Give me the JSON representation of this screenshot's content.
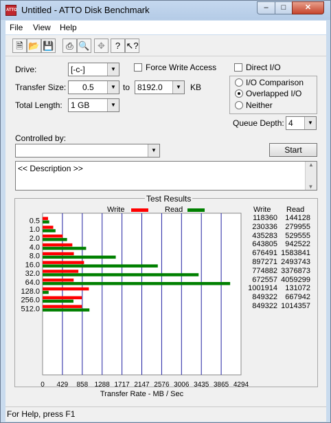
{
  "window": {
    "title": "Untitled - ATTO Disk Benchmark",
    "app_icon_text": "ATTO"
  },
  "menu": {
    "items": [
      "File",
      "View",
      "Help"
    ]
  },
  "toolbar": {
    "buttons": [
      "new-icon",
      "open-icon",
      "save-icon",
      "print-icon",
      "print-preview-icon",
      "move-icon",
      "help-icon",
      "context-help-icon"
    ]
  },
  "form": {
    "drive_label": "Drive:",
    "drive_value": "[-c-]",
    "force_write_label": "Force Write Access",
    "direct_io_label": "Direct I/O",
    "transfer_size_label": "Transfer Size:",
    "transfer_from": "0.5",
    "to_label": "to",
    "transfer_to": "8192.0",
    "kb_label": "KB",
    "total_length_label": "Total Length:",
    "total_length_value": "1 GB",
    "io_comparison_label": "I/O Comparison",
    "overlapped_io_label": "Overlapped I/O",
    "neither_label": "Neither",
    "queue_depth_label": "Queue Depth:",
    "queue_depth_value": "4",
    "controlled_by_label": "Controlled by:",
    "controlled_by_value": "",
    "start_label": "Start",
    "description_text": "<< Description >>"
  },
  "results": {
    "group_title": "Test Results",
    "write_col": "Write",
    "read_col": "Read",
    "rows": [
      {
        "write": "118360",
        "read": "144128"
      },
      {
        "write": "230336",
        "read": "279955"
      },
      {
        "write": "435283",
        "read": "529555"
      },
      {
        "write": "643805",
        "read": "942522"
      },
      {
        "write": "676491",
        "read": "1583841"
      },
      {
        "write": "897271",
        "read": "2493743"
      },
      {
        "write": "774882",
        "read": "3376873"
      },
      {
        "write": "672557",
        "read": "4059299"
      },
      {
        "write": "1001914",
        "read": "131072"
      },
      {
        "write": "849322",
        "read": "667942"
      },
      {
        "write": "849322",
        "read": "1014357"
      }
    ]
  },
  "chart_data": {
    "type": "bar",
    "orientation": "horizontal",
    "categories": [
      "0.5",
      "1.0",
      "2.0",
      "4.0",
      "8.0",
      "16.0",
      "32.0",
      "64.0",
      "128.0",
      "256.0",
      "512.0"
    ],
    "series": [
      {
        "name": "Write",
        "color": "#ff0000",
        "values": [
          118360,
          230336,
          435283,
          643805,
          676491,
          897271,
          774882,
          672557,
          1001914,
          849322,
          849322
        ]
      },
      {
        "name": "Read",
        "color": "#008000",
        "values": [
          144128,
          279955,
          529555,
          942522,
          1583841,
          2493743,
          3376873,
          4059299,
          131072,
          667942,
          1014357
        ]
      }
    ],
    "xticks": [
      "0",
      "429",
      "858",
      "1288",
      "1717",
      "2147",
      "2576",
      "3006",
      "3435",
      "3865",
      "4294"
    ],
    "xlim": [
      0,
      4294967
    ],
    "xlabel": "Transfer Rate - MB / Sec",
    "legend_position": "top",
    "grid_color": "#1e1ea0"
  },
  "status": {
    "text": "For Help, press F1"
  }
}
